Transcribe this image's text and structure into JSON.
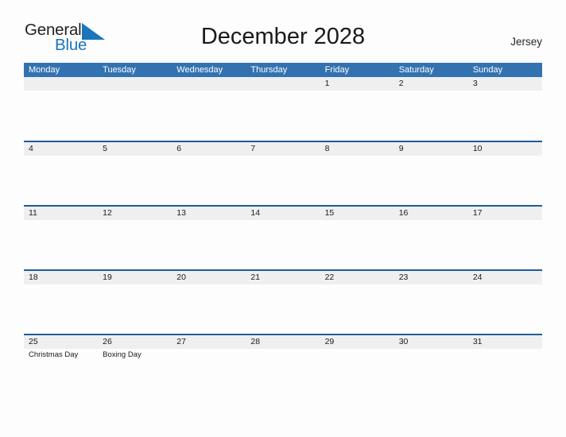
{
  "brand": {
    "name_part1": "General",
    "name_part2": "Blue",
    "flag_icon": "flag-triangle-icon",
    "flag_color": "#1b75bb"
  },
  "header": {
    "title": "December 2028",
    "region": "Jersey"
  },
  "colors": {
    "weekday_header_bg": "#3372b0",
    "week_separator": "#1f5c99",
    "date_band_bg": "#efefef",
    "page_bg": "#fdfdfd",
    "text": "#1a1a1a"
  },
  "calendar": {
    "weekdays": [
      "Monday",
      "Tuesday",
      "Wednesday",
      "Thursday",
      "Friday",
      "Saturday",
      "Sunday"
    ],
    "weeks": [
      [
        {
          "date": "",
          "event": ""
        },
        {
          "date": "",
          "event": ""
        },
        {
          "date": "",
          "event": ""
        },
        {
          "date": "",
          "event": ""
        },
        {
          "date": "1",
          "event": ""
        },
        {
          "date": "2",
          "event": ""
        },
        {
          "date": "3",
          "event": ""
        }
      ],
      [
        {
          "date": "4",
          "event": ""
        },
        {
          "date": "5",
          "event": ""
        },
        {
          "date": "6",
          "event": ""
        },
        {
          "date": "7",
          "event": ""
        },
        {
          "date": "8",
          "event": ""
        },
        {
          "date": "9",
          "event": ""
        },
        {
          "date": "10",
          "event": ""
        }
      ],
      [
        {
          "date": "11",
          "event": ""
        },
        {
          "date": "12",
          "event": ""
        },
        {
          "date": "13",
          "event": ""
        },
        {
          "date": "14",
          "event": ""
        },
        {
          "date": "15",
          "event": ""
        },
        {
          "date": "16",
          "event": ""
        },
        {
          "date": "17",
          "event": ""
        }
      ],
      [
        {
          "date": "18",
          "event": ""
        },
        {
          "date": "19",
          "event": ""
        },
        {
          "date": "20",
          "event": ""
        },
        {
          "date": "21",
          "event": ""
        },
        {
          "date": "22",
          "event": ""
        },
        {
          "date": "23",
          "event": ""
        },
        {
          "date": "24",
          "event": ""
        }
      ],
      [
        {
          "date": "25",
          "event": "Christmas Day"
        },
        {
          "date": "26",
          "event": "Boxing Day"
        },
        {
          "date": "27",
          "event": ""
        },
        {
          "date": "28",
          "event": ""
        },
        {
          "date": "29",
          "event": ""
        },
        {
          "date": "30",
          "event": ""
        },
        {
          "date": "31",
          "event": ""
        }
      ]
    ]
  }
}
